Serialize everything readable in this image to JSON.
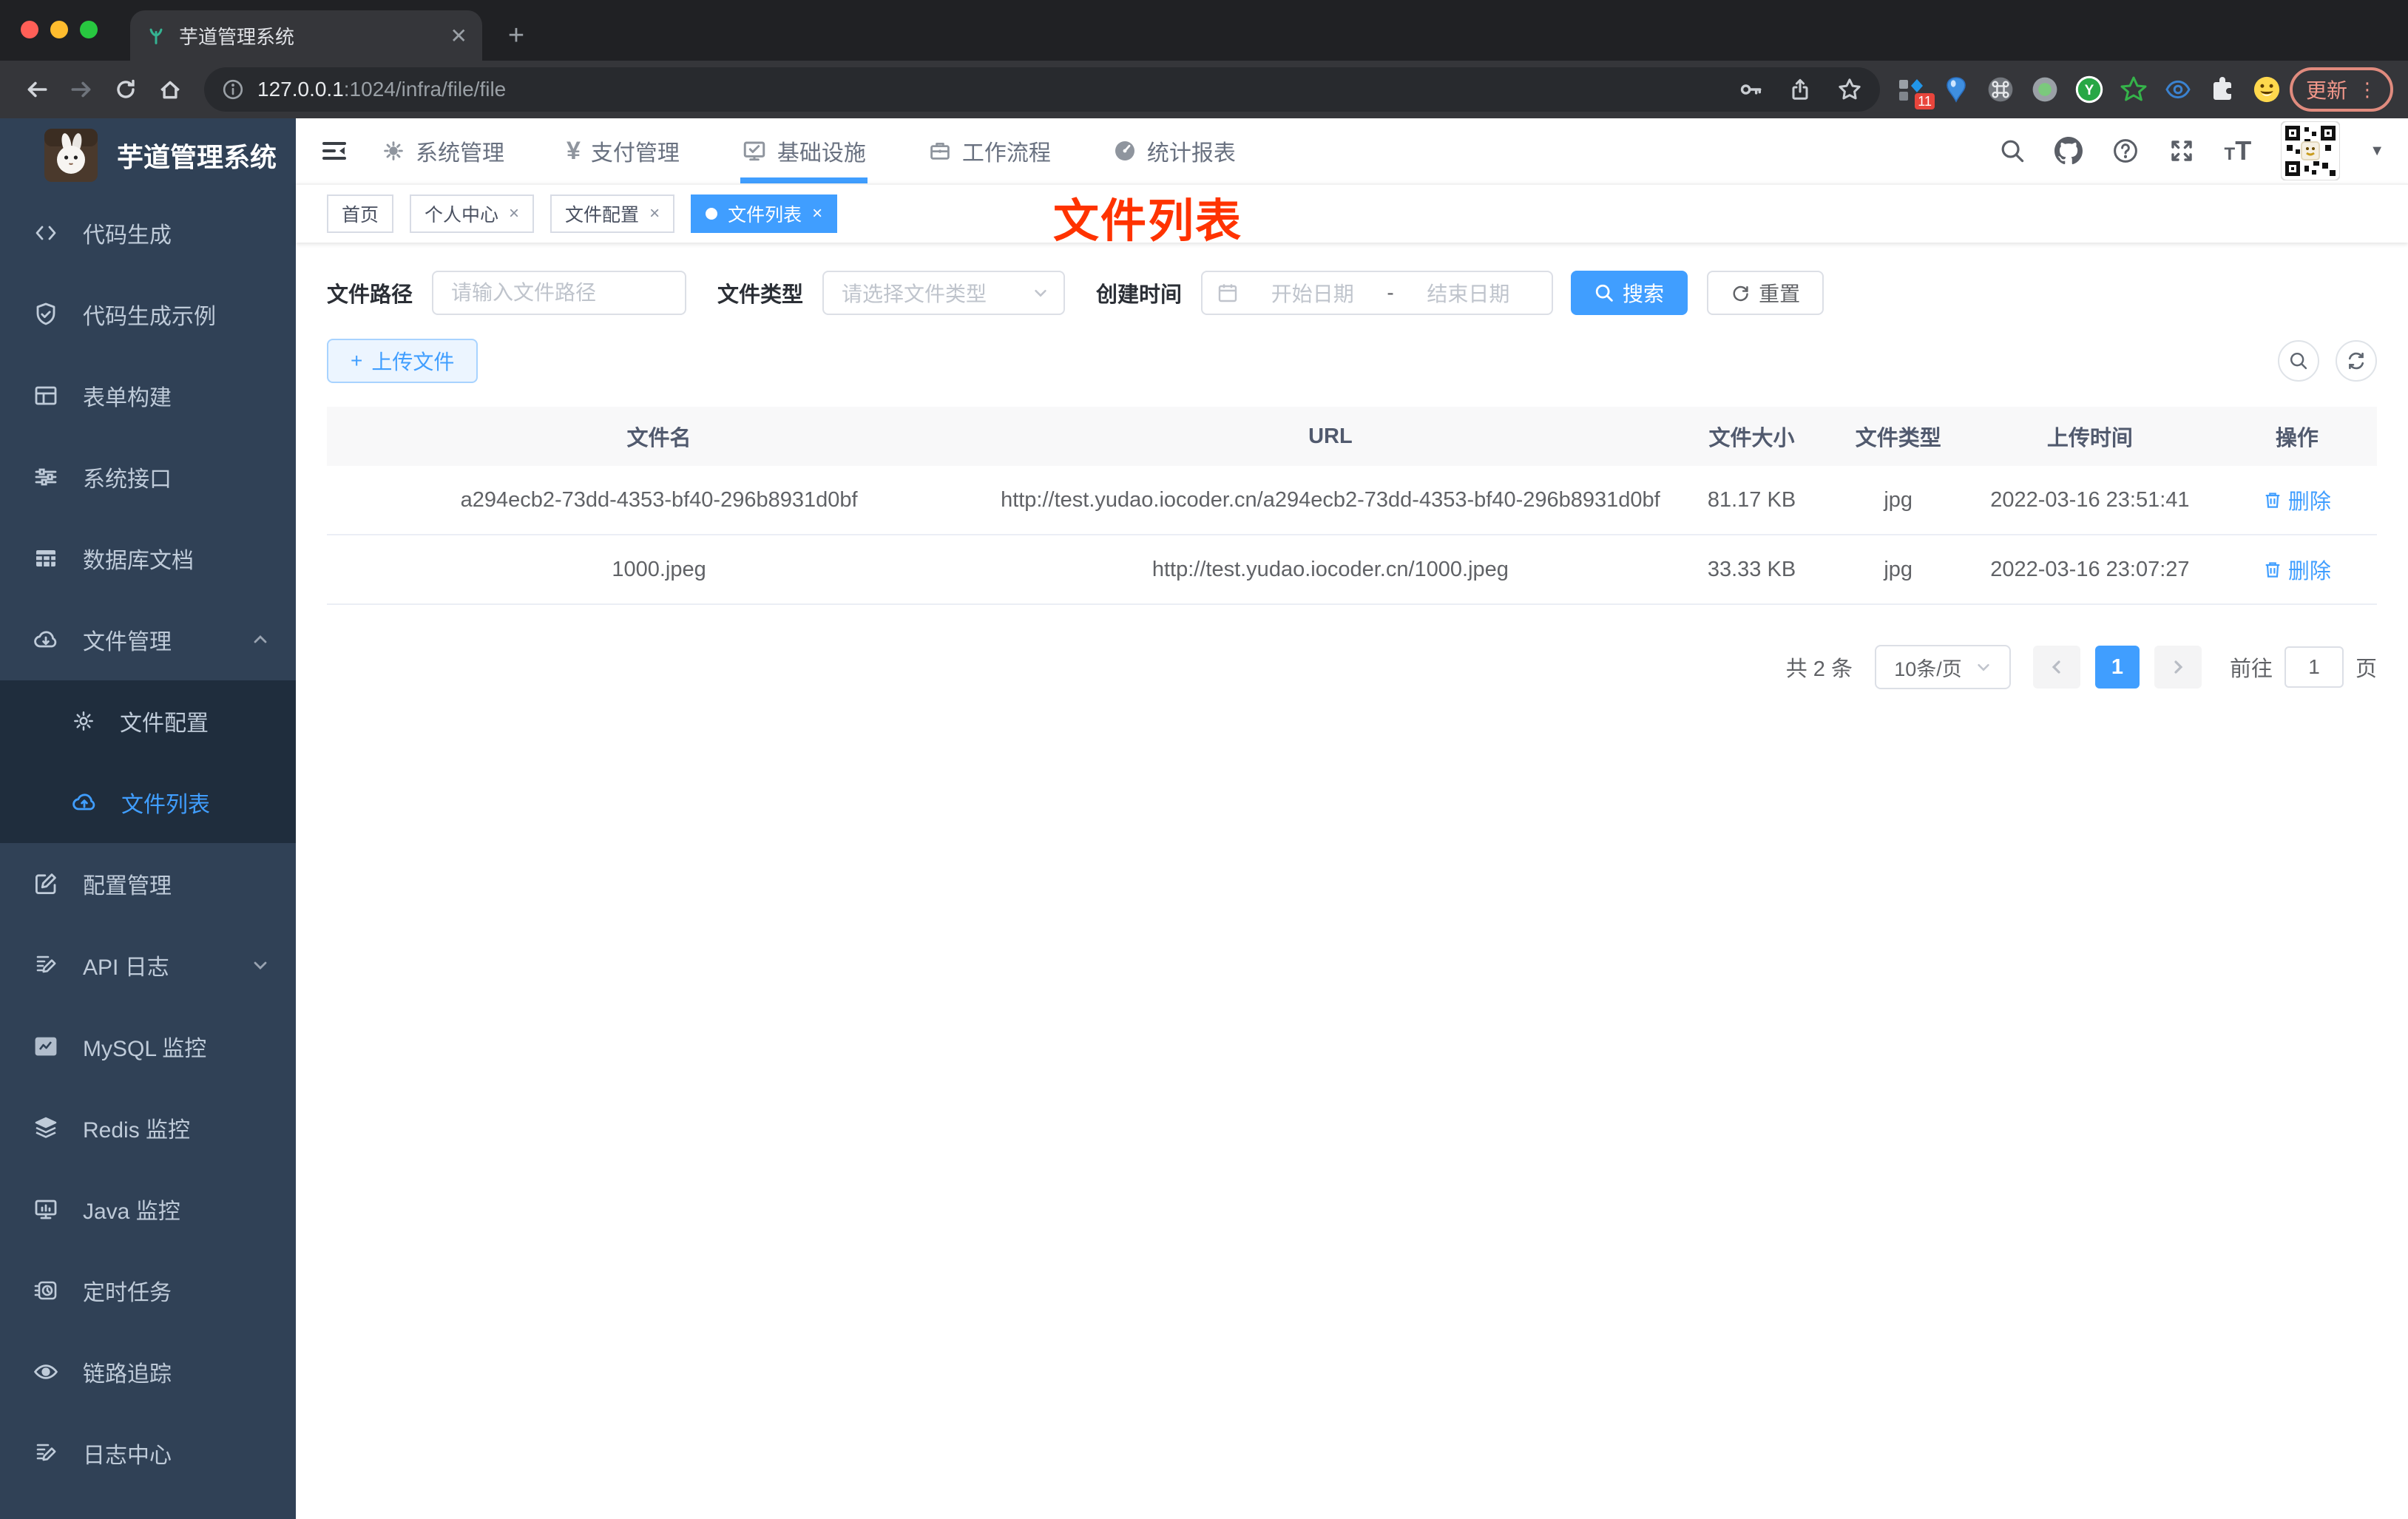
{
  "browser": {
    "tab_title": "芋道管理系统",
    "url_host": "127.0.0.1",
    "url_rest": ":1024/infra/file/file",
    "extension_badge": "11",
    "update_label": "更新"
  },
  "sidebar": {
    "title": "芋道管理系统",
    "items": [
      {
        "label": "代码生成"
      },
      {
        "label": "代码生成示例"
      },
      {
        "label": "表单构建"
      },
      {
        "label": "系统接口"
      },
      {
        "label": "数据库文档"
      },
      {
        "label": "文件管理",
        "expanded": true
      },
      {
        "label": "文件配置",
        "child": true
      },
      {
        "label": "文件列表",
        "child": true,
        "active": true
      },
      {
        "label": "配置管理"
      },
      {
        "label": "API 日志",
        "collapsed": true
      },
      {
        "label": "MySQL 监控"
      },
      {
        "label": "Redis 监控"
      },
      {
        "label": "Java 监控"
      },
      {
        "label": "定时任务"
      },
      {
        "label": "链路追踪"
      },
      {
        "label": "日志中心"
      }
    ]
  },
  "header": {
    "nav": [
      {
        "label": "系统管理"
      },
      {
        "label": "支付管理"
      },
      {
        "label": "基础设施",
        "active": true
      },
      {
        "label": "工作流程"
      },
      {
        "label": "统计报表"
      }
    ]
  },
  "tags": [
    {
      "label": "首页",
      "closable": false
    },
    {
      "label": "个人中心",
      "closable": true
    },
    {
      "label": "文件配置",
      "closable": true
    },
    {
      "label": "文件列表",
      "closable": true,
      "active": true
    }
  ],
  "annotation": {
    "text": "文件列表",
    "color": "#ff3300"
  },
  "filters": {
    "path_label": "文件路径",
    "path_placeholder": "请输入文件路径",
    "type_label": "文件类型",
    "type_placeholder": "请选择文件类型",
    "time_label": "创建时间",
    "start_placeholder": "开始日期",
    "range_separator": "-",
    "end_placeholder": "结束日期",
    "search_label": "搜索",
    "reset_label": "重置"
  },
  "toolbar": {
    "upload_label": "上传文件"
  },
  "table": {
    "headers": [
      "文件名",
      "URL",
      "文件大小",
      "文件类型",
      "上传时间",
      "操作"
    ],
    "rows": [
      {
        "name": "a294ecb2-73dd-4353-bf40-296b8931d0bf",
        "url": "http://test.yudao.iocoder.cn/a294ecb2-73dd-4353-bf40-296b8931d0bf",
        "size": "81.17 KB",
        "type": "jpg",
        "time": "2022-03-16 23:51:41",
        "action": "删除"
      },
      {
        "name": "1000.jpeg",
        "url": "http://test.yudao.iocoder.cn/1000.jpeg",
        "size": "33.33 KB",
        "type": "jpg",
        "time": "2022-03-16 23:07:27",
        "action": "删除"
      }
    ]
  },
  "pagination": {
    "total_text": "共 2 条",
    "page_size": "10条/页",
    "current_page": "1",
    "goto_label": "前往",
    "goto_value": "1",
    "page_suffix": "页"
  },
  "colors": {
    "accent": "#409eff",
    "sidebar_bg": "#304156",
    "submenu_bg": "#1f2d3d",
    "annotation_red": "#ff3300"
  }
}
